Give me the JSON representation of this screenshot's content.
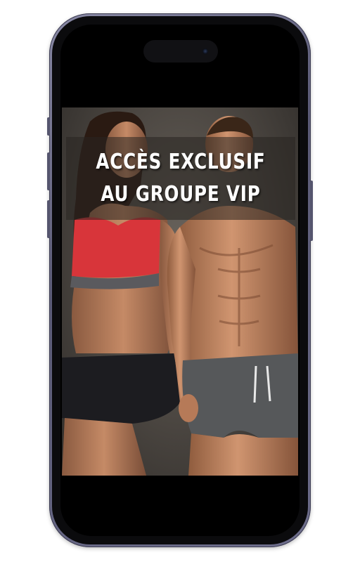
{
  "device": {
    "model_icon": "smartphone-frame-icon",
    "camera_icon": "front-camera-icon"
  },
  "screen": {
    "image_semantic": "fitness-couple-photo",
    "caption": "ACCÈS EXCLUSIF AU GROUPE VIP"
  },
  "colors": {
    "frame": "#6e6e8c",
    "bezel": "#0b0b0d",
    "sports_bra": "#d8353a",
    "caption_text": "#ffffff"
  }
}
